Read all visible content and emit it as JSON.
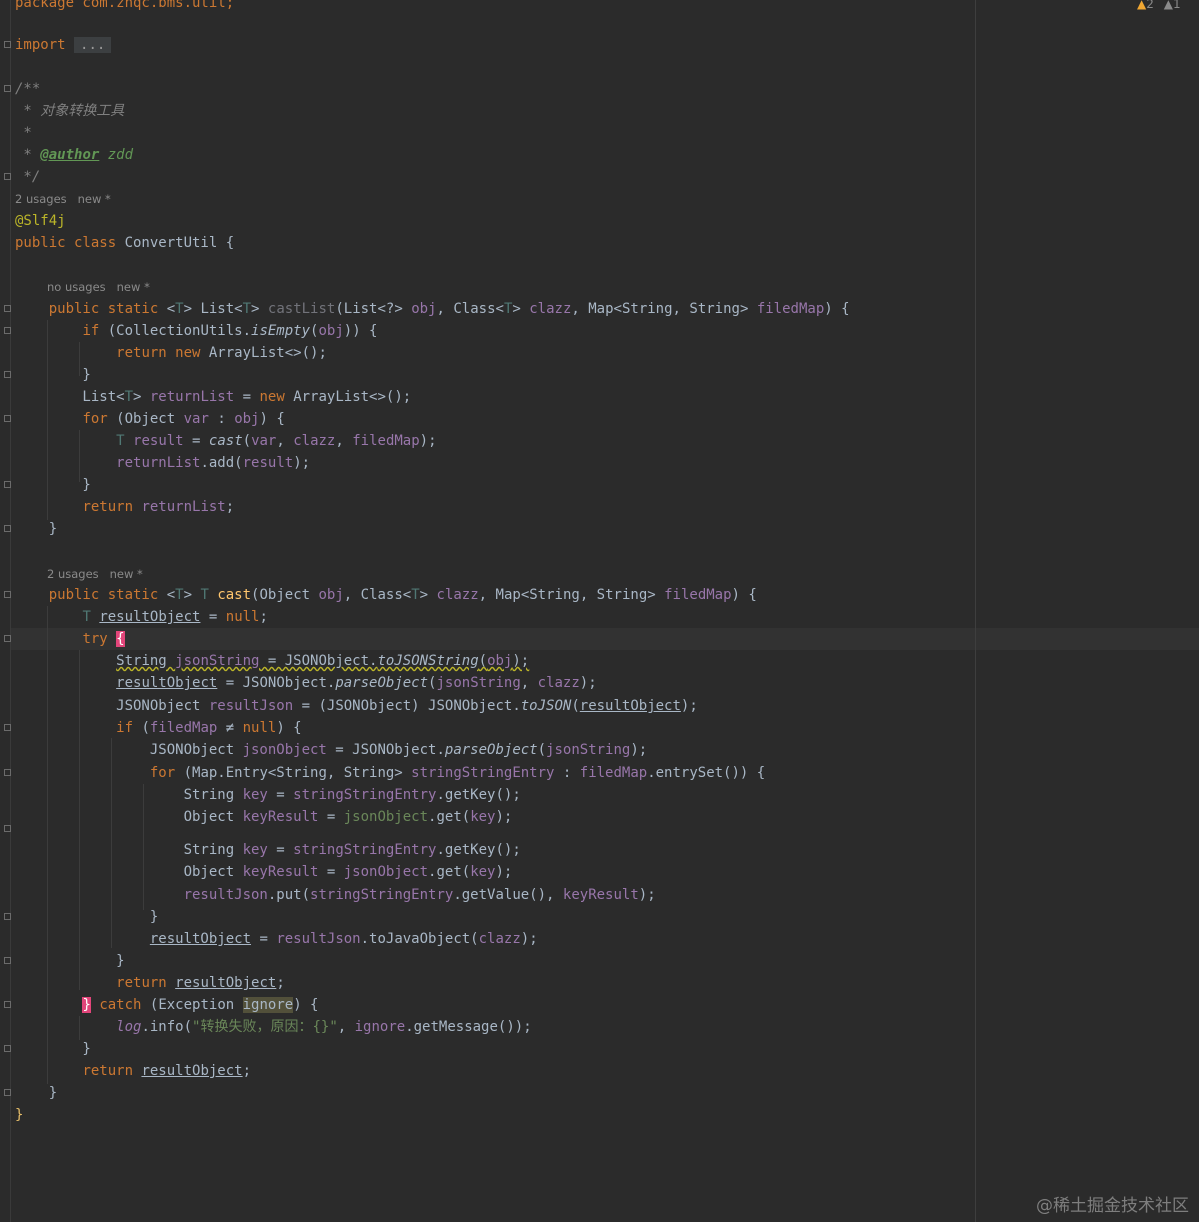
{
  "status": {
    "warnings": "2",
    "weak_warnings": "1"
  },
  "code": {
    "package_line": "package com.zhqc.bms.util;",
    "import_keyword": "import",
    "import_fold": "...",
    "doc_open": "/**",
    "doc_desc": " * 对象转换工具",
    "doc_star": " *",
    "doc_author_tag": "@author",
    "doc_author_name": " zdd",
    "doc_close": " */",
    "class_hint": "2 usages   new *",
    "annotation": "@Slf4j",
    "class_decl_kw": "public class ",
    "class_name": "ConvertUtil",
    "class_brace": " {",
    "castlist_hint": "no usages   new *",
    "cast_hint": "2 usages   new *"
  },
  "watermark": "@稀土掘金技术社区"
}
